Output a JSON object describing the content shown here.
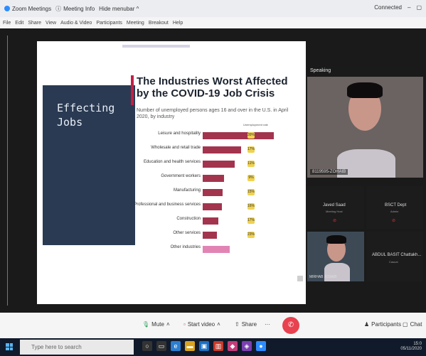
{
  "titlebar": {
    "items": [
      "Zoom Meetings",
      "Meeting Info",
      "Hide menubar ^"
    ],
    "connected": "Connected",
    "min": "–",
    "restore": "▢"
  },
  "menubar": {
    "items": [
      "File",
      "Edit",
      "Share",
      "View",
      "Audio & Video",
      "Participants",
      "Meeting",
      "Breakout",
      "Help"
    ]
  },
  "slide": {
    "panel_text": "Effecting\nJobs",
    "title": "The Industries Worst Affected by the COVID-19 Job Crisis",
    "subtitle": "Number of unemployed persons ages 16 and over in the U.S. in April 2020, by industry",
    "legend_label": "Unemployment rate"
  },
  "chart_data": {
    "type": "bar",
    "orientation": "horizontal",
    "title": "The Industries Worst Affected by the COVID-19 Job Crisis",
    "subtitle": "Number of unemployed persons ages 16 and over in the U.S. in April 2020, by industry",
    "categories": [
      "Leisure and hospitality",
      "Wholesale and retail trade",
      "Education and health services",
      "Government workers",
      "Manufacturing",
      "Professional and business services",
      "Construction",
      "Other services",
      "Other industries"
    ],
    "values": [
      100,
      54,
      45,
      30,
      28,
      27,
      22,
      20,
      38
    ],
    "percent_labels": [
      "39%",
      "17%",
      "11%",
      "9%",
      "15%",
      "16%",
      "17%",
      "23%",
      ""
    ],
    "value_labels": [
      "",
      "",
      "",
      "",
      "",
      "",
      "",
      "",
      ""
    ],
    "colors": {
      "bar": "#a3344e",
      "last_bar": "#e184b4",
      "pct": "#f0d250"
    }
  },
  "participants": {
    "speaking_label": "Speaking",
    "main_name": "8119595-ZOHAIB",
    "tile2_name": "Javed Saad",
    "tile2_sub": "Meeting Host",
    "tile3_name": "BSCT Dept",
    "tile3_sub": "Admin",
    "tile4_name": "MIRHAB JOSAIB",
    "tile5_name": "ABDUL BASIT Chattakh...",
    "tile5_sub": "Casual"
  },
  "controls": {
    "mute": "Mute",
    "start_video": "Start video",
    "share": "Share",
    "more": "···",
    "participants": "Participants",
    "chat": "Chat"
  },
  "taskbar": {
    "search_placeholder": "Type here to search",
    "time": "15:0",
    "date": "05/11/2020"
  }
}
